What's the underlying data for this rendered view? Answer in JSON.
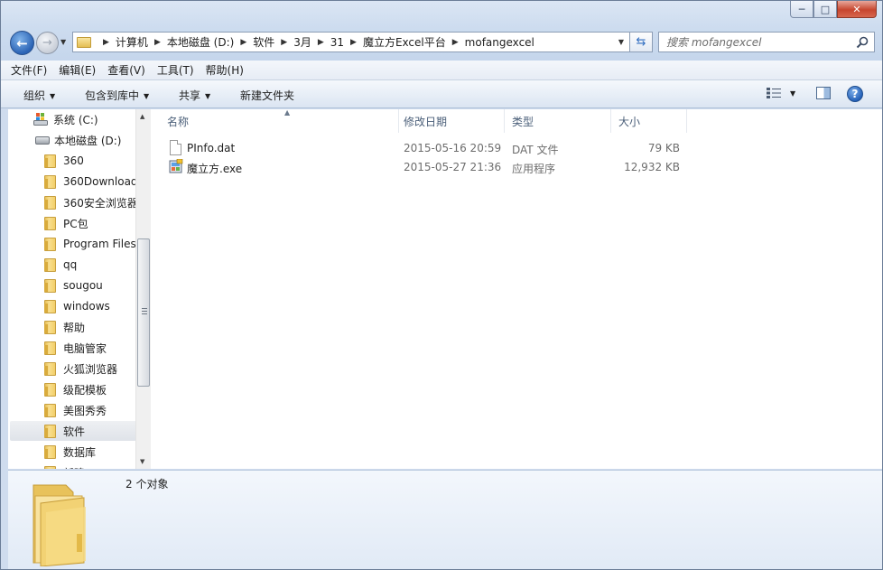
{
  "window": {
    "caption_buttons": {
      "minimize": "─",
      "maximize": "□",
      "close": "✕"
    }
  },
  "navigation": {
    "back_glyph": "←",
    "forward_glyph": "→"
  },
  "address_bar": {
    "breadcrumbs": [
      "计算机",
      "本地磁盘 (D:)",
      "软件",
      "3月",
      "31",
      "魔立方Excel平台",
      "mofangexcel"
    ]
  },
  "search": {
    "placeholder": "搜索 mofangexcel"
  },
  "menu": [
    "文件(F)",
    "编辑(E)",
    "查看(V)",
    "工具(T)",
    "帮助(H)"
  ],
  "toolbar": {
    "organize": "组织",
    "include_in_library": "包含到库中",
    "share": "共享",
    "new_folder": "新建文件夹",
    "help_glyph": "?"
  },
  "nav_tree": {
    "system_drive": "系统 (C:)",
    "local_disk": "本地磁盘 (D:)",
    "folders": [
      "360",
      "360Downloads",
      "360安全浏览器",
      "PC包",
      "Program Files",
      "qq",
      "sougou",
      "windows",
      "帮助",
      "电脑管家",
      "火狐浏览器",
      "级配模板",
      "美图秀秀",
      "软件",
      "数据库",
      "新建"
    ],
    "selected": "软件"
  },
  "file_list": {
    "columns": {
      "name": "名称",
      "modified": "修改日期",
      "type": "类型",
      "size": "大小"
    },
    "files": [
      {
        "name": "PInfo.dat",
        "modified": "2015-05-16 20:59",
        "type": "DAT 文件",
        "size": "79 KB",
        "icon": "document-icon"
      },
      {
        "name": "魔立方.exe",
        "modified": "2015-05-27 21:36",
        "type": "应用程序",
        "size": "12,932 KB",
        "icon": "application-icon"
      }
    ]
  },
  "details": {
    "item_count": "2 个对象"
  },
  "colors": {
    "chrome": "#cddcef",
    "selection": "#dfe3e9",
    "header_text": "#4c607a",
    "folder": "#f3cf69"
  }
}
